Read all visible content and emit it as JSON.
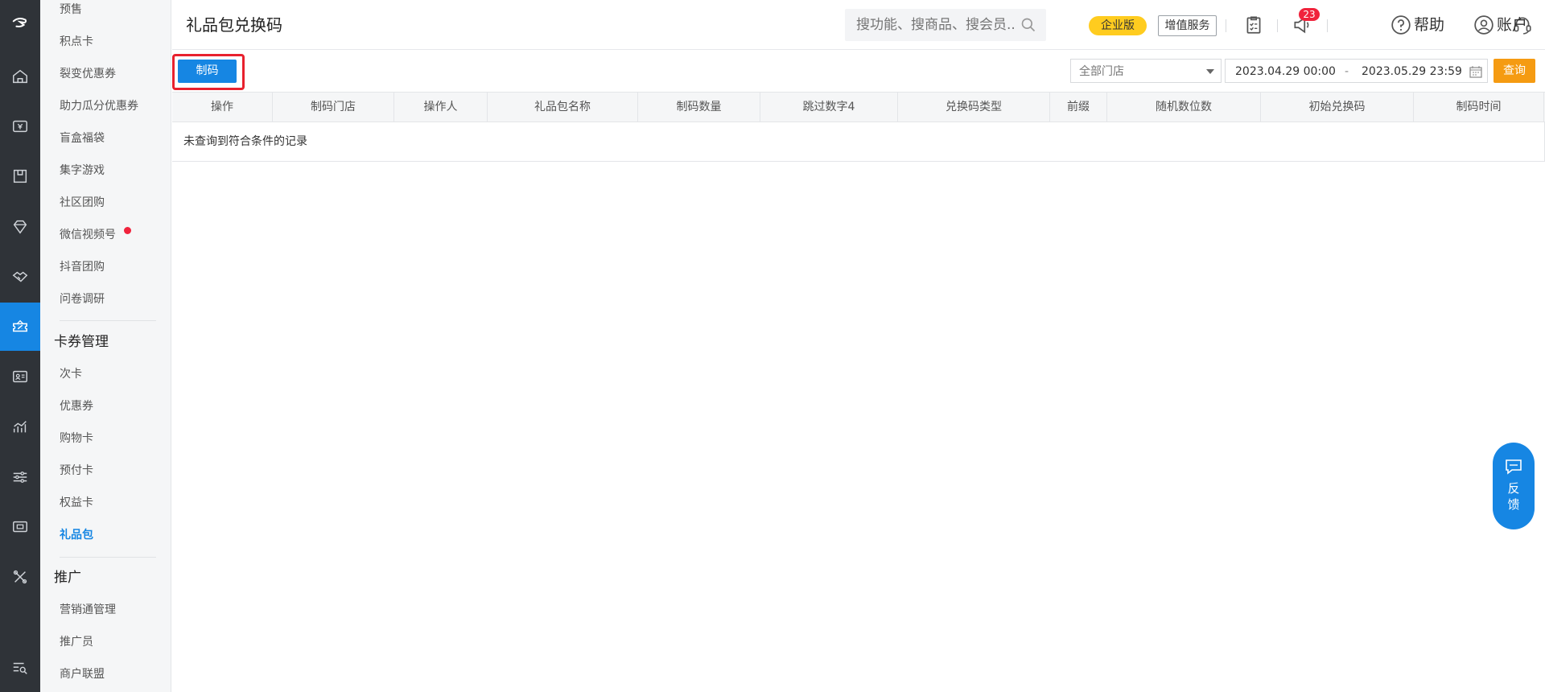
{
  "header": {
    "title": "礼品包兑换码",
    "search_placeholder": "搜功能、搜商品、搜会员...",
    "edition_badge": "企业版",
    "value_added": "增值服务",
    "notification_count": "23",
    "help_label": "帮助",
    "account_label": "账户"
  },
  "sidebar": {
    "group1": [
      "预售",
      "积点卡",
      "裂变优惠券",
      "助力瓜分优惠券",
      "盲盒福袋",
      "集字游戏",
      "社区团购",
      "微信视频号",
      "抖音团购",
      "问卷调研"
    ],
    "section_cards": "卡券管理",
    "group2": [
      "次卡",
      "优惠券",
      "购物卡",
      "预付卡",
      "权益卡",
      "礼品包"
    ],
    "active_item": "礼品包",
    "section_promo": "推广",
    "group3": [
      "营销通管理",
      "推广员",
      "商户联盟"
    ]
  },
  "toolbar": {
    "make_code_label": "制码",
    "store_select": "全部门店",
    "date_start": "2023.04.29 00:00",
    "date_separator": "-",
    "date_end": "2023.05.29 23:59",
    "query_label": "查询"
  },
  "table": {
    "columns": [
      "操作",
      "制码门店",
      "操作人",
      "礼品包名称",
      "制码数量",
      "跳过数字4",
      "兑换码类型",
      "前缀",
      "随机数位数",
      "初始兑换码",
      "制码时间"
    ],
    "empty_text": "未查询到符合条件的记录"
  },
  "feedback": {
    "line1": "反",
    "line2": "馈"
  },
  "colors": {
    "primary": "#1686e3",
    "rail_bg": "#2f3338",
    "query_orange": "#f59b12",
    "badge_yellow": "#ffcc1f",
    "alert_red": "#e8212e"
  }
}
